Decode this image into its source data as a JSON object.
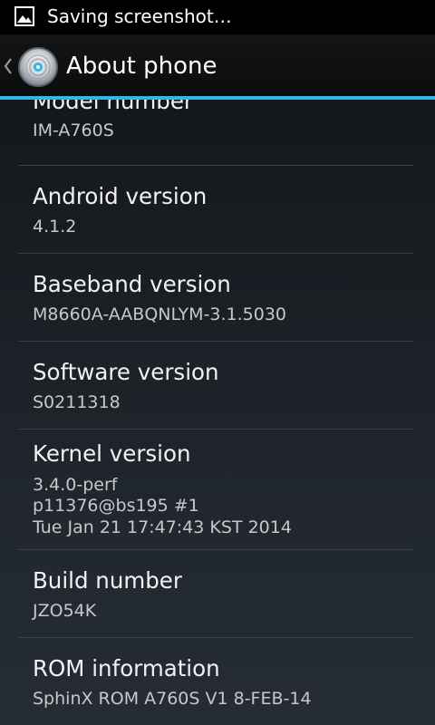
{
  "status_bar": {
    "notification_icon": "image-icon",
    "text": "Saving screenshot…"
  },
  "action_bar": {
    "up_icon": "chevron-left-icon",
    "app_icon": "settings-disc-icon",
    "title": "About phone",
    "accent_color": "#33b5e5"
  },
  "items": [
    {
      "title": "Model number",
      "summary": "IM-A760S"
    },
    {
      "title": "Android version",
      "summary": "4.1.2"
    },
    {
      "title": "Baseband version",
      "summary": "M8660A-AABQNLYM-3.1.5030"
    },
    {
      "title": "Software version",
      "summary": "S0211318"
    },
    {
      "title": "Kernel version",
      "summary_lines": [
        "3.4.0-perf",
        "p11376@bs195 #1",
        "Tue Jan 21 17:47:43 KST 2014"
      ]
    },
    {
      "title": "Build number",
      "summary": "JZO54K"
    },
    {
      "title": "ROM information",
      "summary": "SphinX ROM A760S V1 8-FEB-14"
    }
  ]
}
